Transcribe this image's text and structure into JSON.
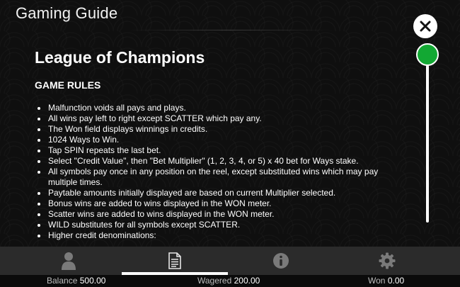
{
  "header": {
    "title": "Gaming Guide"
  },
  "content": {
    "title": "League of Champions",
    "section_heading": "GAME RULES",
    "rules": [
      "Malfunction voids all pays and plays.",
      "All wins pay left to right except SCATTER which pay any.",
      "The Won field displays winnings in credits.",
      "1024 Ways to Win.",
      "Tap SPIN repeats the last bet.",
      "Select \"Credit Value\", then \"Bet Multiplier\" (1, 2, 3, 4, or 5) x 40 bet for Ways stake.",
      "All symbols pay once in any position on the reel, except substituted wins which may pay multiple times.",
      "Paytable amounts initially displayed are based on current Multiplier selected.",
      "Bonus wins are added to wins displayed in the WON meter.",
      "Scatter wins are added to wins displayed in the WON meter.",
      "WILD substitutes for all symbols except SCATTER.",
      "Higher credit denominations:"
    ]
  },
  "controls": {
    "close_icon": "close-icon",
    "scroll_thumb_color": "#12a833",
    "scroll_position": 0
  },
  "tabs": [
    {
      "icon": "person-icon",
      "active": false
    },
    {
      "icon": "document-icon",
      "active": true
    },
    {
      "icon": "info-icon",
      "active": false
    },
    {
      "icon": "gear-icon",
      "active": false
    }
  ],
  "status": {
    "balance_label": "Balance",
    "balance_value": "500.00",
    "wagered_label": "Wagered",
    "wagered_value": "200.00",
    "won_label": "Won",
    "won_value": "0.00"
  }
}
